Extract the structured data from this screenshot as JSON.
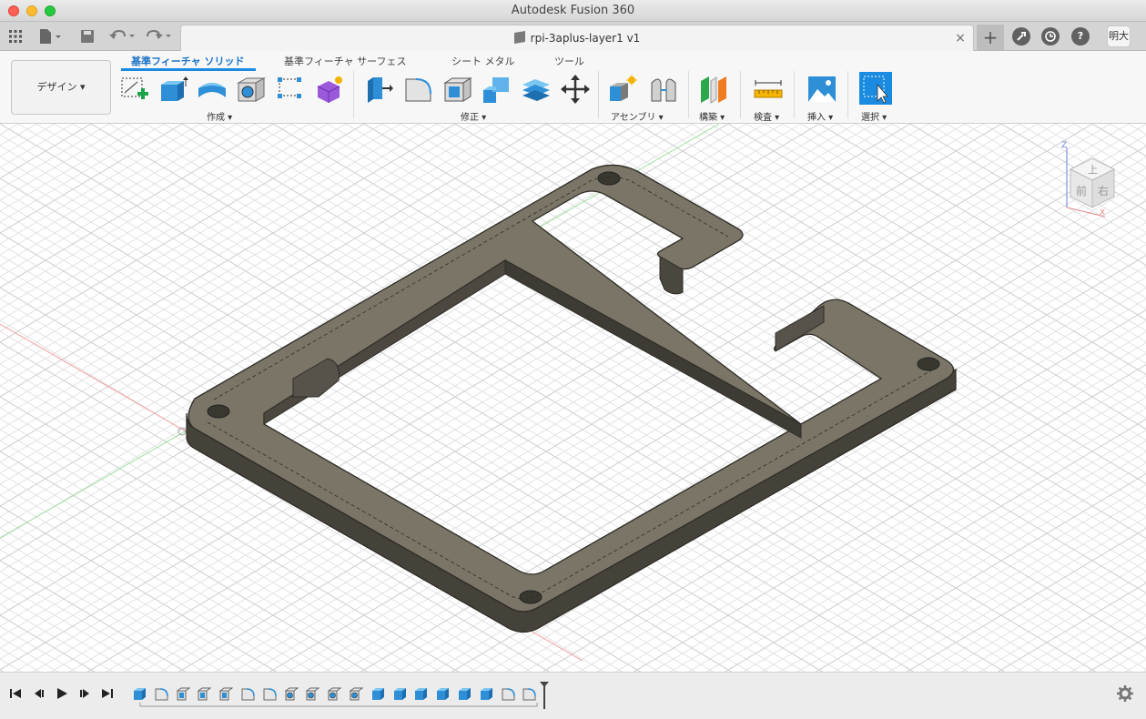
{
  "window": {
    "title": "Autodesk Fusion 360"
  },
  "tabbar": {
    "document_title": "rpi-3aplus-layer1 v1",
    "close_glyph": "×",
    "new_tab_glyph": "+",
    "user_initials": "明大",
    "icons": [
      "grid-icon",
      "file-icon",
      "save-icon",
      "undo-icon",
      "redo-icon",
      "extensions-icon",
      "job-status-icon",
      "help-icon"
    ]
  },
  "ribbon": {
    "workspace_label": "デザイン ▾",
    "tabs": [
      {
        "label": "基準フィーチャ ソリッド",
        "active": true
      },
      {
        "label": "基準フィーチャ サーフェス",
        "active": false
      },
      {
        "label": "シート メタル",
        "active": false
      },
      {
        "label": "ツール",
        "active": false
      }
    ],
    "groups": [
      {
        "label": "作成 ▾"
      },
      {
        "label": "修正 ▾"
      },
      {
        "label": "アセンブリ ▾"
      },
      {
        "label": "構築 ▾"
      },
      {
        "label": "検査 ▾"
      },
      {
        "label": "挿入 ▾"
      },
      {
        "label": "選択 ▾"
      }
    ],
    "accent_color": "#1a8be0"
  },
  "viewcube": {
    "top": "上",
    "front": "前",
    "right": "右",
    "axis_z": "Z",
    "axis_x": "X"
  },
  "timeline": {
    "controls": [
      "skip-to-start",
      "step-back",
      "play",
      "step-forward",
      "skip-to-end"
    ],
    "feature_count": 19
  }
}
